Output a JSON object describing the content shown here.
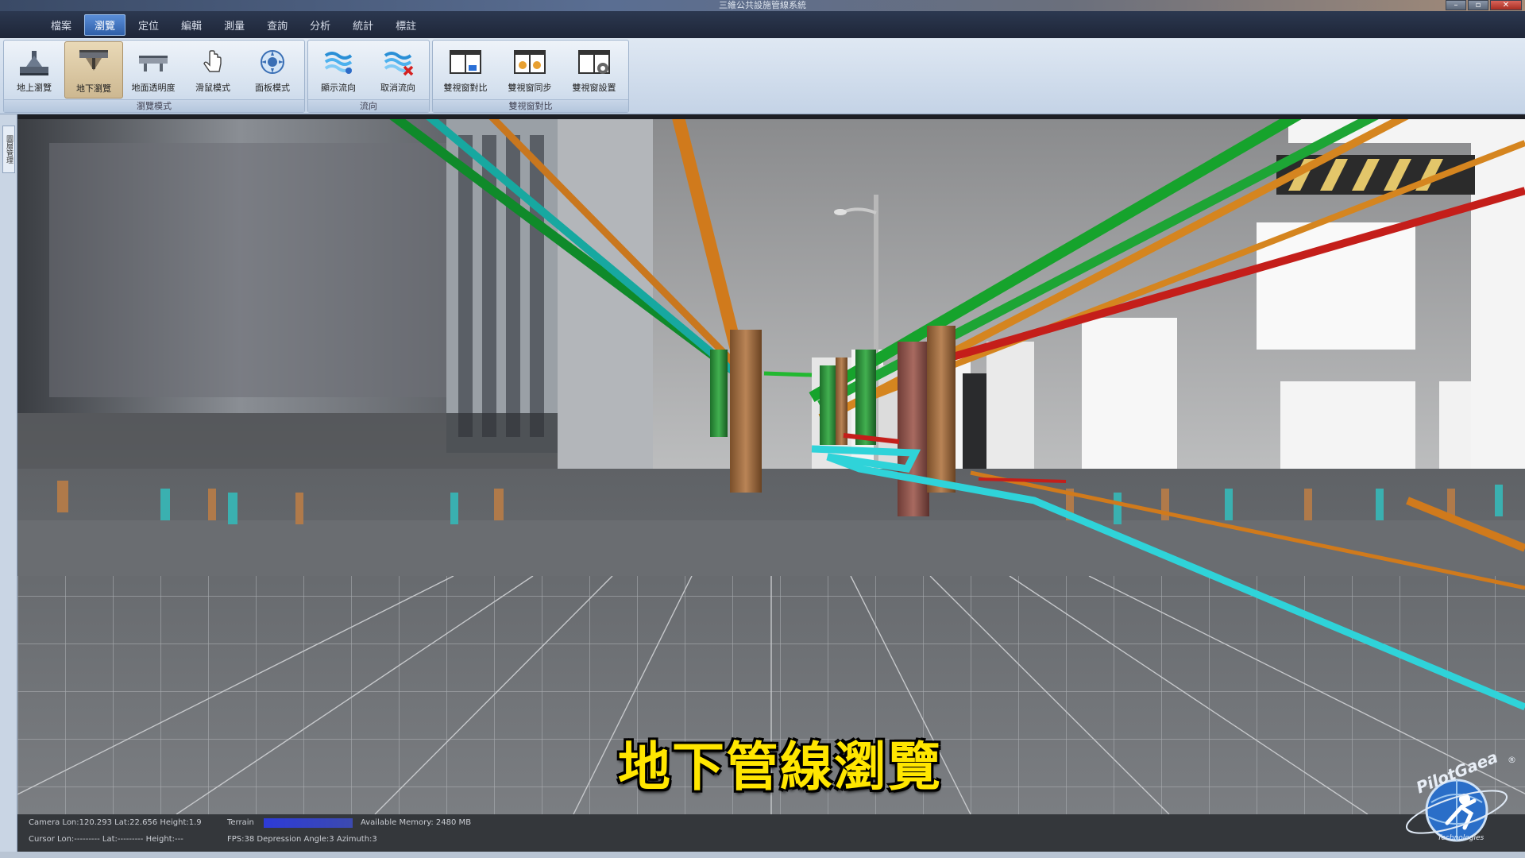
{
  "window": {
    "title": "三維公共設施管線系統"
  },
  "menu": [
    {
      "label": "檔案",
      "active": false
    },
    {
      "label": "瀏覽",
      "active": true
    },
    {
      "label": "定位",
      "active": false
    },
    {
      "label": "編輯",
      "active": false
    },
    {
      "label": "測量",
      "active": false
    },
    {
      "label": "查詢",
      "active": false
    },
    {
      "label": "分析",
      "active": false
    },
    {
      "label": "統計",
      "active": false
    },
    {
      "label": "標註",
      "active": false
    }
  ],
  "ribbon": {
    "groups": [
      {
        "label": "瀏覽模式",
        "buttons": [
          {
            "label": "地上瀏覽",
            "icon": "above-ground-icon"
          },
          {
            "label": "地下瀏覽",
            "icon": "underground-icon"
          },
          {
            "label": "地面透明度",
            "icon": "ground-transparency-icon"
          },
          {
            "label": "滑鼠模式",
            "icon": "mouse-hand-icon"
          },
          {
            "label": "面板模式",
            "icon": "panel-compass-icon"
          }
        ]
      },
      {
        "label": "流向",
        "buttons": [
          {
            "label": "顯示流向",
            "icon": "show-flow-icon"
          },
          {
            "label": "取消流向",
            "icon": "cancel-flow-icon"
          }
        ]
      },
      {
        "label": "雙視窗對比",
        "buttons": [
          {
            "label": "雙視窗對比",
            "icon": "dual-window-compare-icon"
          },
          {
            "label": "雙視窗同步",
            "icon": "dual-window-sync-icon"
          },
          {
            "label": "雙視窗設置",
            "icon": "dual-window-settings-icon"
          }
        ]
      }
    ]
  },
  "dock": {
    "tab_label": "圖層管理"
  },
  "status": {
    "camera": "Camera Lon:120.293 Lat:22.656 Height:1.9",
    "terrain_label": "Terrain",
    "memory": "Available Memory: 2480 MB",
    "cursor": "Cursor Lon:--------- Lat:--------- Height:---",
    "fps": "FPS:38  Depression Angle:3  Azimuth:3"
  },
  "subtitle": "地下管線瀏覽",
  "logo": {
    "brand": "PilotGaea",
    "sub": "Technologies",
    "mark": "®"
  },
  "colors": {
    "pipe_green": "#1f9a2a",
    "pipe_orange": "#d07a1c",
    "pipe_red": "#c0201c",
    "pipe_cyan": "#2fd3d9",
    "pipe_teal": "#1b8f8f",
    "subtitle": "#ffe600"
  }
}
